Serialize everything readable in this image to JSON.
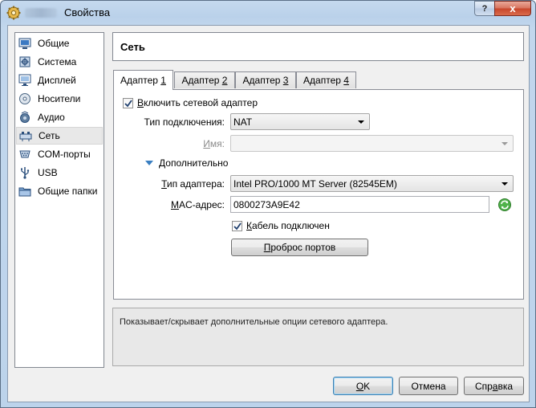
{
  "window": {
    "title": "Свойства",
    "help_button": "?",
    "close_button": "x"
  },
  "sidebar": {
    "items": [
      {
        "label": "Общие",
        "icon": "general-icon"
      },
      {
        "label": "Система",
        "icon": "system-icon"
      },
      {
        "label": "Дисплей",
        "icon": "display-icon"
      },
      {
        "label": "Носители",
        "icon": "storage-icon"
      },
      {
        "label": "Аудио",
        "icon": "audio-icon"
      },
      {
        "label": "Сеть",
        "icon": "network-icon",
        "selected": true
      },
      {
        "label": "COM-порты",
        "icon": "serial-ports-icon"
      },
      {
        "label": "USB",
        "icon": "usb-icon"
      },
      {
        "label": "Общие папки",
        "icon": "shared-folders-icon"
      }
    ]
  },
  "section": {
    "title": "Сеть"
  },
  "tabs": [
    {
      "prefix": "Адаптер ",
      "mnemonic": "1",
      "active": true
    },
    {
      "prefix": "Адаптер ",
      "mnemonic": "2"
    },
    {
      "prefix": "Адаптер ",
      "mnemonic": "3"
    },
    {
      "prefix": "Адаптер ",
      "mnemonic": "4"
    }
  ],
  "adapter": {
    "enable": {
      "pre": "",
      "mnemonic": "В",
      "post": "ключить сетевой адаптер",
      "checked": true
    },
    "attachment": {
      "label_pre": "Тип по",
      "label_mnemonic": "д",
      "label_post": "ключения:",
      "value": "NAT"
    },
    "name": {
      "label_pre": "",
      "label_mnemonic": "И",
      "label_post": "мя:",
      "value": ""
    },
    "advanced": {
      "pre": "",
      "mnemonic": "Д",
      "post": "ополнительно"
    },
    "adapter_type": {
      "label_pre": "",
      "label_mnemonic": "Т",
      "label_post": "ип адаптера:",
      "value": "Intel PRO/1000 MT Server (82545EM)"
    },
    "mac": {
      "label_pre": "",
      "label_mnemonic": "M",
      "label_post": "AC-адрес:",
      "value": "0800273A9E42"
    },
    "cable": {
      "pre": "",
      "mnemonic": "К",
      "post": "абель подключен",
      "checked": true
    },
    "port_forwarding": {
      "pre": "",
      "mnemonic": "П",
      "post": "роброс портов"
    }
  },
  "description": "Показывает/скрывает дополнительные опции сетевого адаптера.",
  "buttons": {
    "ok": {
      "pre": "",
      "mnemonic": "O",
      "post": "K"
    },
    "cancel": {
      "label": "Отмена"
    },
    "help": {
      "pre": "Спр",
      "mnemonic": "а",
      "post": "вка"
    }
  },
  "colors": {
    "title_bar": "#bcd3eb",
    "close_button": "#c7452a",
    "default_button_border": "#3c7fb1"
  }
}
